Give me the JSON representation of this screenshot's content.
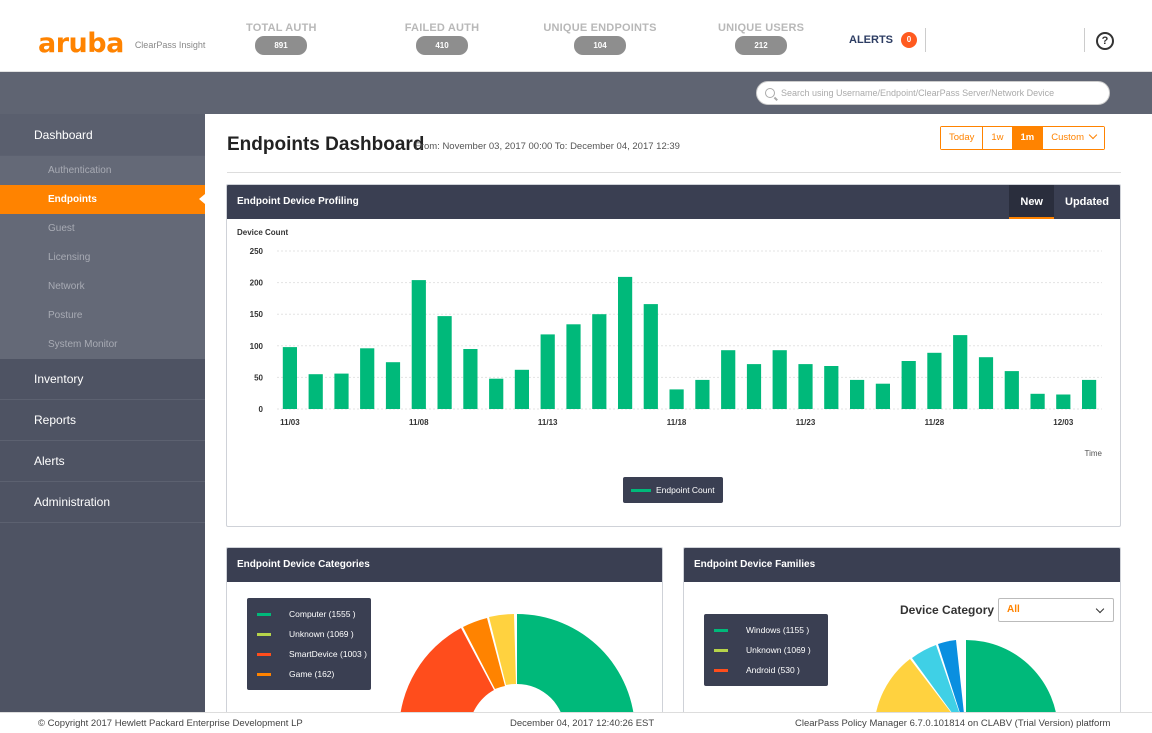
{
  "brand": {
    "logo": "aruba",
    "product": "ClearPass Insight",
    "logo_color": "#ff8300"
  },
  "stats": [
    {
      "label": "TOTAL AUTH",
      "value": "891"
    },
    {
      "label": "FAILED AUTH",
      "value": "410"
    },
    {
      "label": "UNIQUE ENDPOINTS",
      "value": "104"
    },
    {
      "label": "UNIQUE USERS",
      "value": "212"
    }
  ],
  "alerts": {
    "label": "ALERTS",
    "count": "0"
  },
  "help": {
    "icon": "help-circle-icon",
    "glyph": "?"
  },
  "search": {
    "placeholder": "Search using Username/Endpoint/ClearPass Server/Network Device"
  },
  "sidebar": {
    "dashboard": "Dashboard",
    "sub_items": [
      "Authentication",
      "Endpoints",
      "Guest",
      "Licensing",
      "Network",
      "Posture",
      "System Monitor"
    ],
    "active": "Endpoints",
    "others": [
      "Inventory",
      "Reports",
      "Alerts",
      "Administration"
    ]
  },
  "page": {
    "title": "Endpoints Dashboard",
    "range": "From: November 03, 2017 00:00 To: December 04, 2017 12:39",
    "range_buttons": [
      "Today",
      "1w",
      "1m",
      "Custom"
    ],
    "active_range": "1m"
  },
  "profiling": {
    "title": "Endpoint Device Profiling",
    "tabs": [
      "New",
      "Updated"
    ],
    "selected_tab": "New"
  },
  "chart_data": {
    "type": "bar",
    "title": "Endpoint Device Profiling",
    "ylabel": "Device Count",
    "xlabel": "Time",
    "ylim": [
      0,
      250
    ],
    "yticks": [
      0,
      50,
      100,
      150,
      200,
      250
    ],
    "x_tick_labels": [
      "11/03",
      "11/08",
      "11/13",
      "11/18",
      "11/23",
      "11/28",
      "12/03"
    ],
    "categories": [
      "11/03",
      "11/04",
      "11/05",
      "11/06",
      "11/07",
      "11/08",
      "11/09",
      "11/10",
      "11/11",
      "11/12",
      "11/13",
      "11/14",
      "11/15",
      "11/16",
      "11/17",
      "11/18",
      "11/19",
      "11/20",
      "11/21",
      "11/22",
      "11/23",
      "11/24",
      "11/25",
      "11/26",
      "11/27",
      "11/28",
      "11/29",
      "11/30",
      "12/01",
      "12/02",
      "12/03",
      "12/04"
    ],
    "series": [
      {
        "name": "Endpoint Count",
        "color": "#00b97a",
        "values": [
          98,
          55,
          56,
          96,
          74,
          204,
          147,
          95,
          48,
          62,
          118,
          134,
          150,
          209,
          166,
          31,
          46,
          93,
          71,
          93,
          71,
          68,
          46,
          40,
          76,
          89,
          117,
          82,
          60,
          24,
          23,
          46
        ]
      }
    ],
    "grid": true,
    "legend": "bottom-center"
  },
  "categories_panel": {
    "title": "Endpoint Device Categories",
    "legend": [
      {
        "label": "Computer (1555 )",
        "color": "#00b97a"
      },
      {
        "label": "Unknown (1069 )",
        "color": "#b6d44a"
      },
      {
        "label": "SmartDevice (1003 )",
        "color": "#ff4d1c"
      },
      {
        "label": "Game (162)",
        "color": "#ff8300"
      }
    ]
  },
  "families_panel": {
    "title": "Endpoint Device Families",
    "filter_label": "Device Category",
    "filter_value": "All",
    "legend": [
      {
        "label": "Windows (1155 )",
        "color": "#00b97a"
      },
      {
        "label": "Unknown (1069 )",
        "color": "#b6d44a"
      },
      {
        "label": "Android (530 )",
        "color": "#ff4d1c"
      }
    ]
  },
  "footer": {
    "copyright": "© Copyright 2017 Hewlett Packard Enterprise Development LP",
    "timestamp": "December 04, 2017 12:40:26 EST",
    "platform": "ClearPass Policy Manager 6.7.0.101814 on CLABV (Trial Version) platform"
  }
}
